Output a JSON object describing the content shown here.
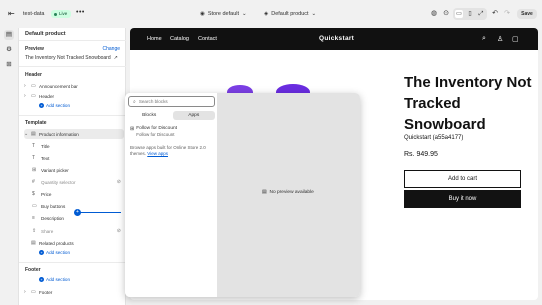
{
  "topbar": {
    "store_name": "test-data",
    "status": "Live",
    "theme": "Store default",
    "template": "Default product",
    "save": "Save"
  },
  "panel": {
    "title": "Default product",
    "preview_label": "Preview",
    "change": "Change",
    "preview_product": "The Inventory Not Tracked Snowboard",
    "header_label": "Header",
    "header_rows": [
      "Announcement bar",
      "Header"
    ],
    "add_section": "Add section",
    "template_label": "Template",
    "product_information": "Product information",
    "blocks": [
      "Title",
      "Text",
      "Variant picker",
      "Quantity selector",
      "Price",
      "Buy buttons",
      "Description",
      "Share"
    ],
    "related_products": "Related products",
    "footer_label": "Footer",
    "footer_rows": [
      "Footer"
    ]
  },
  "storefront": {
    "nav_links": [
      "Home",
      "Catalog",
      "Contact"
    ],
    "brand": "Quickstart",
    "product_title": "The Inventory Not Tracked Snowboard",
    "vendor": "Quickstart (a55a4177)",
    "price": "Rs. 949.95",
    "add_to_cart": "Add to cart",
    "buy_now": "Buy it now"
  },
  "modal": {
    "search_placeholder": "Search blocks",
    "tabs": [
      "Blocks",
      "Apps"
    ],
    "active_tab": "Apps",
    "app_name": "Follow for Discount",
    "app_sub": "Follow for Discount",
    "browse_text": "Browse apps built for Online Store 2.0 themes.",
    "view_apps": "View apps",
    "no_preview": "No preview available"
  },
  "colors": {
    "accent": "#005bd3",
    "live_bg": "#cdfee1",
    "nav_bg": "#111111",
    "buy_bg": "#121212"
  }
}
